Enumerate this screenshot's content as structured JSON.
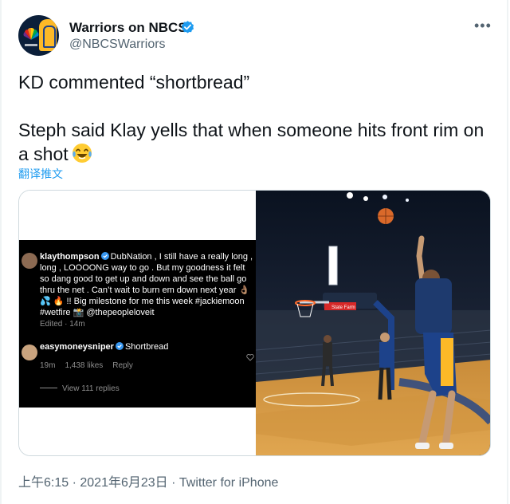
{
  "author": {
    "display_name": "Warriors on NBCS",
    "handle": "@NBCSWarriors",
    "verified": true,
    "avatar_icon": "warriors-nbc-logo"
  },
  "more_icon": "more-horizontal-icon",
  "more_glyph": "•••",
  "tweet": {
    "line1": "KD commented “shortbread”",
    "line2": "Steph said Klay yells that when someone hits front rim on",
    "line3": "a shot",
    "emoji": "laughing-crying-face"
  },
  "translate_label": "翻译推文",
  "media": {
    "screenshot": {
      "post_user": "klaythompson",
      "post_text": "DubNation , I still have a really long , long , LOOOONG way to go . But my goodness it felt so dang good to get up and down and see the ball go thru the net . Can’t wait to burn em down next year 👌🏽 💦 🔥 !! Big milestone for me this week #jackiemoon #wetfire 📸 @thepeopleloveit",
      "post_meta": "Edited · 14m",
      "reply_user": "easymoneysniper",
      "reply_text": "Shortbread",
      "reply_time": "19m",
      "reply_likes": "1,438 likes",
      "reply_action": "Reply",
      "view_replies": "View 111 replies"
    },
    "photo": {
      "description_icon": "basketball-court-photo",
      "sign_text": "State Farm"
    }
  },
  "footer": {
    "time": "上午6:15",
    "sep1": " · ",
    "date": "2021年6月23日",
    "sep2": " · ",
    "source": "Twitter for iPhone"
  },
  "colors": {
    "link": "#1d9bf0",
    "verified": "#1d9bf0",
    "secondary_text": "#536471",
    "warriors_gold": "#fdb927",
    "warriors_blue": "#1d428a"
  }
}
